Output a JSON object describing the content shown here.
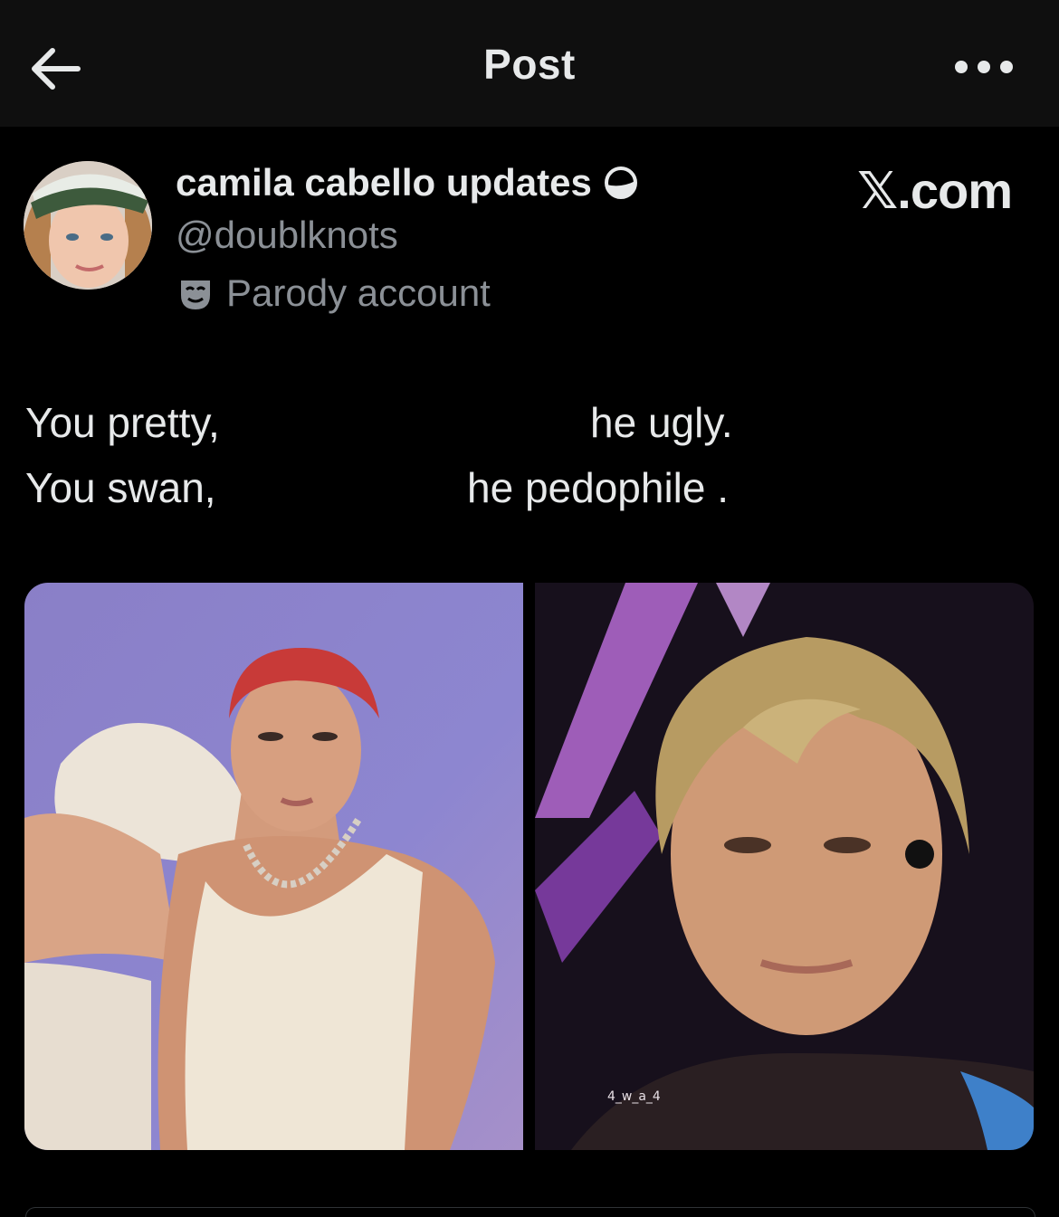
{
  "header": {
    "title": "Post",
    "back_icon": "arrow-left-icon",
    "more_icon": "more-horizontal-icon"
  },
  "post": {
    "author_name": "camila cabello updates",
    "verified_icon": "verified-badge-icon",
    "handle": "@doublknots",
    "parody_label": "Parody account",
    "parody_icon": "mask-icon",
    "brand": "𝕏.com",
    "lines": [
      {
        "left": "You pretty,",
        "right": "he ugly."
      },
      {
        "left": "You swan,",
        "right": "he pedophile ."
      }
    ],
    "images": [
      {
        "name": "photo-red-hair-man"
      },
      {
        "name": "photo-blond-hair-man",
        "watermark": "4_w_a_4"
      }
    ]
  },
  "colors": {
    "background": "#000000",
    "topbar": "#0f0f0f",
    "text": "#e7e9ea",
    "secondary": "#8b9096"
  }
}
